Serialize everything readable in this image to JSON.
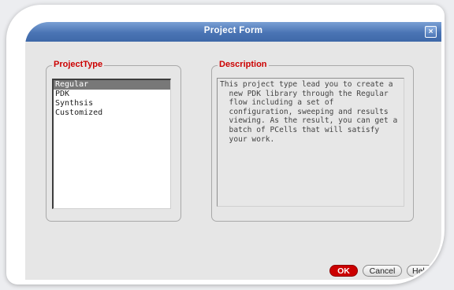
{
  "window": {
    "title": "Project Form",
    "close_glyph": "×"
  },
  "project_type": {
    "legend": "ProjectType",
    "items": [
      "Regular",
      "PDK",
      "Synthsis",
      "Customized"
    ],
    "selected": "Regular"
  },
  "description": {
    "legend": "Description",
    "text": "This project type lead you to create a\n  new PDK library through the Regular\n  flow including a set of\n  configuration, sweeping and results\n  viewing. As the result, you can get a\n  batch of PCells that will satisfy\n  your work."
  },
  "buttons": {
    "ok": "OK",
    "cancel": "Cancel",
    "help": "Help"
  },
  "colors": {
    "accent": "#cc0000",
    "titlebar": "#4a74b4",
    "selection": "#787878"
  },
  "icons": {
    "close": "close-icon"
  }
}
